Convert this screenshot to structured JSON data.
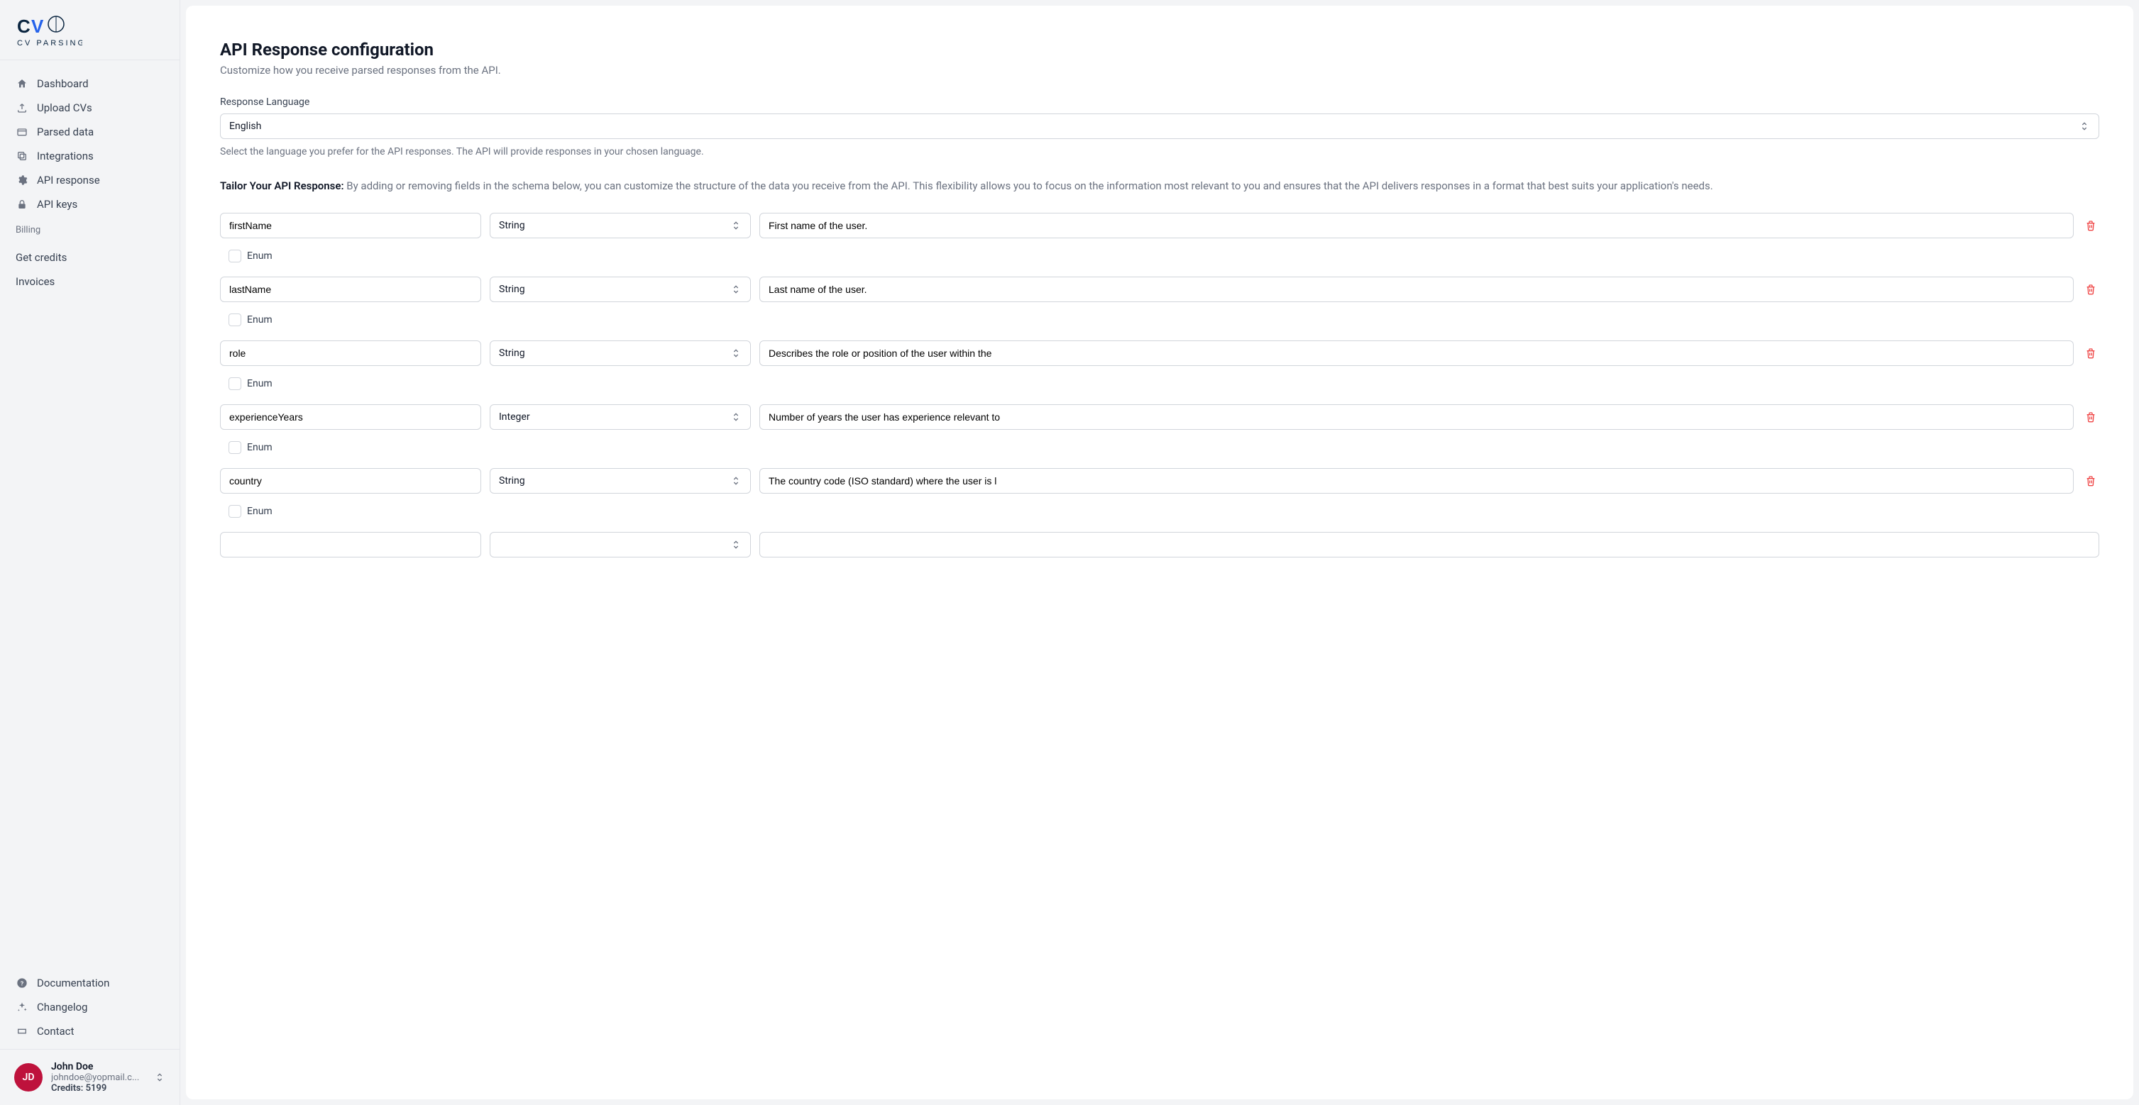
{
  "brand": {
    "text": "CV PARSING"
  },
  "nav": {
    "main": [
      {
        "label": "Dashboard",
        "icon": "home"
      },
      {
        "label": "Upload CVs",
        "icon": "upload"
      },
      {
        "label": "Parsed data",
        "icon": "card"
      },
      {
        "label": "Integrations",
        "icon": "copy"
      },
      {
        "label": "API response",
        "icon": "gear"
      },
      {
        "label": "API keys",
        "icon": "lock"
      }
    ],
    "billing_label": "Billing",
    "billing": [
      {
        "label": "Get credits"
      },
      {
        "label": "Invoices"
      }
    ],
    "bottom": [
      {
        "label": "Documentation",
        "icon": "help"
      },
      {
        "label": "Changelog",
        "icon": "sparkles"
      },
      {
        "label": "Contact",
        "icon": "ticket"
      }
    ]
  },
  "user": {
    "initials": "JD",
    "name": "John Doe",
    "email": "johndoe@yopmail.c...",
    "credits_label": "Credits: 5199"
  },
  "page": {
    "title": "API Response configuration",
    "subtitle": "Customize how you receive parsed responses from the API.",
    "lang_label": "Response Language",
    "lang_value": "English",
    "lang_help": "Select the language you prefer for the API responses. The API will provide responses in your chosen language.",
    "tailor_bold": "Tailor Your API Response:",
    "tailor_rest": " By adding or removing fields in the schema below, you can customize the structure of the data you receive from the API. This flexibility allows you to focus on the information most relevant to you and ensures that the API delivers responses in a format that best suits your application's needs.",
    "enum_label": "Enum"
  },
  "fields": [
    {
      "name": "firstName",
      "type": "String",
      "desc": "First name of the user."
    },
    {
      "name": "lastName",
      "type": "String",
      "desc": "Last name of the user."
    },
    {
      "name": "role",
      "type": "String",
      "desc": "Describes the role or position of the user within the"
    },
    {
      "name": "experienceYears",
      "type": "Integer",
      "desc": "Number of years the user has experience relevant to"
    },
    {
      "name": "country",
      "type": "String",
      "desc": "The country code (ISO standard) where the user is l"
    }
  ]
}
